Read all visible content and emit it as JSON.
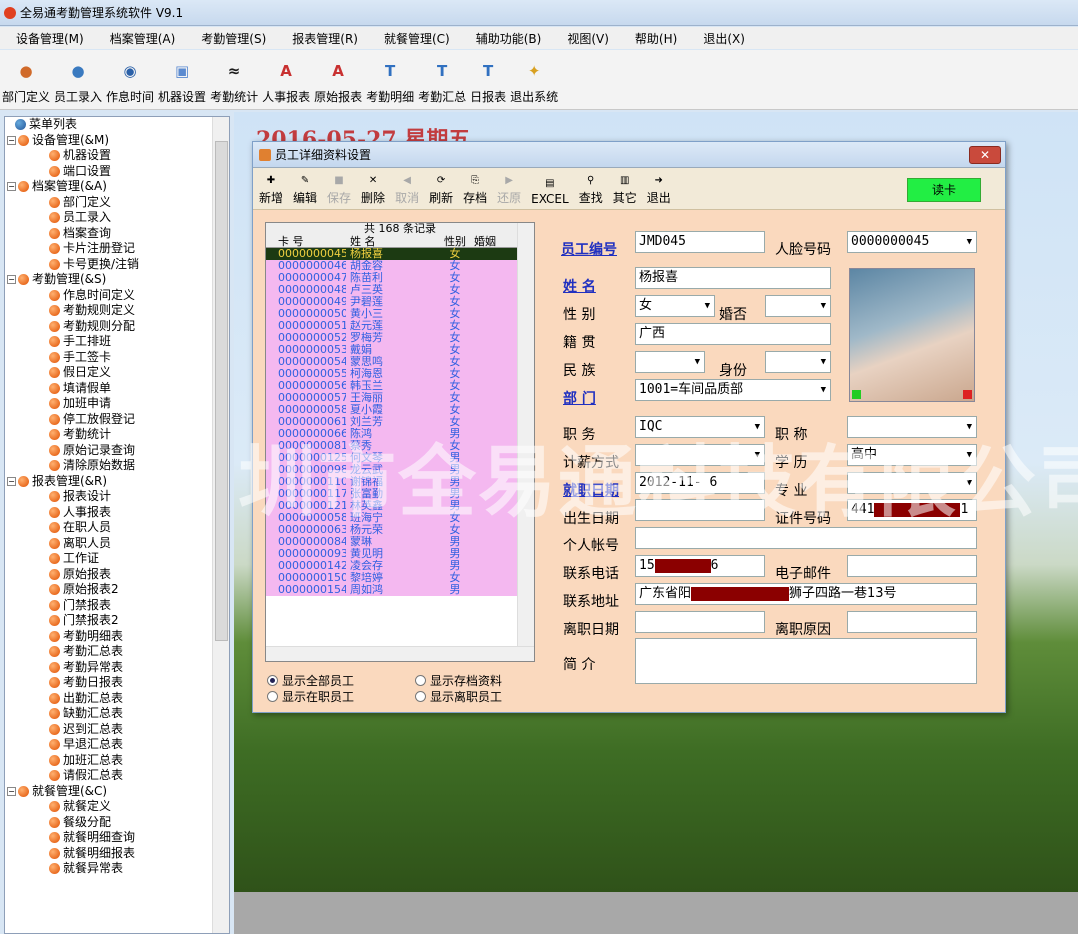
{
  "app": {
    "title": "全易通考勤管理系统软件 V9.1"
  },
  "menu": [
    "设备管理(M)",
    "档案管理(A)",
    "考勤管理(S)",
    "报表管理(R)",
    "就餐管理(C)",
    "辅助功能(B)",
    "视图(V)",
    "帮助(H)",
    "退出(X)"
  ],
  "toolbar": [
    "部门定义",
    "员工录入",
    "作息时间",
    "机器设置",
    "考勤统计",
    "人事报表",
    "原始报表",
    "考勤明细",
    "考勤汇总",
    "日报表",
    "退出系统"
  ],
  "tree": [
    {
      "label": "菜单列表",
      "level": 0
    },
    {
      "label": "设备管理(&M)",
      "level": 1
    },
    {
      "label": "机器设置",
      "level": 2
    },
    {
      "label": "端口设置",
      "level": 2
    },
    {
      "label": "档案管理(&A)",
      "level": 1
    },
    {
      "label": "部门定义",
      "level": 2
    },
    {
      "label": "员工录入",
      "level": 2
    },
    {
      "label": "档案查询",
      "level": 2
    },
    {
      "label": "卡片注册登记",
      "level": 2
    },
    {
      "label": "卡号更换/注销",
      "level": 2
    },
    {
      "label": "考勤管理(&S)",
      "level": 1
    },
    {
      "label": "作息时间定义",
      "level": 2
    },
    {
      "label": "考勤规则定义",
      "level": 2
    },
    {
      "label": "考勤规则分配",
      "level": 2
    },
    {
      "label": "手工排班",
      "level": 2
    },
    {
      "label": "手工签卡",
      "level": 2
    },
    {
      "label": "假日定义",
      "level": 2
    },
    {
      "label": "填请假单",
      "level": 2
    },
    {
      "label": "加班申请",
      "level": 2
    },
    {
      "label": "停工放假登记",
      "level": 2
    },
    {
      "label": "考勤统计",
      "level": 2
    },
    {
      "label": "原始记录查询",
      "level": 2
    },
    {
      "label": "清除原始数据",
      "level": 2
    },
    {
      "label": "报表管理(&R)",
      "level": 1
    },
    {
      "label": "报表设计",
      "level": 2
    },
    {
      "label": "人事报表",
      "level": 2
    },
    {
      "label": "在职人员",
      "level": 2
    },
    {
      "label": "离职人员",
      "level": 2
    },
    {
      "label": "工作证",
      "level": 2
    },
    {
      "label": "原始报表",
      "level": 2
    },
    {
      "label": "原始报表2",
      "level": 2
    },
    {
      "label": "门禁报表",
      "level": 2
    },
    {
      "label": "门禁报表2",
      "level": 2
    },
    {
      "label": "考勤明细表",
      "level": 2
    },
    {
      "label": "考勤汇总表",
      "level": 2
    },
    {
      "label": "考勤异常表",
      "level": 2
    },
    {
      "label": "考勤日报表",
      "level": 2
    },
    {
      "label": "出勤汇总表",
      "level": 2
    },
    {
      "label": "缺勤汇总表",
      "level": 2
    },
    {
      "label": "迟到汇总表",
      "level": 2
    },
    {
      "label": "早退汇总表",
      "level": 2
    },
    {
      "label": "加班汇总表",
      "level": 2
    },
    {
      "label": "请假汇总表",
      "level": 2
    },
    {
      "label": "就餐管理(&C)",
      "level": 1
    },
    {
      "label": "就餐定义",
      "level": 2
    },
    {
      "label": "餐级分配",
      "level": 2
    },
    {
      "label": "就餐明细查询",
      "level": 2
    },
    {
      "label": "就餐明细报表",
      "level": 2
    },
    {
      "label": "就餐异常表",
      "level": 2
    }
  ],
  "desktop": {
    "date": "2016-05-27 星期五",
    "watermark": "圳市全易通科技有限公司"
  },
  "dialog": {
    "title": "员工详细资料设置",
    "toolbar": [
      {
        "label": "新增",
        "enabled": true
      },
      {
        "label": "编辑",
        "enabled": true
      },
      {
        "label": "保存",
        "enabled": false
      },
      {
        "label": "删除",
        "enabled": true
      },
      {
        "label": "取消",
        "enabled": false
      },
      {
        "label": "刷新",
        "enabled": true
      },
      {
        "label": "存档",
        "enabled": true
      },
      {
        "label": "还原",
        "enabled": false
      },
      {
        "label": "EXCEL",
        "enabled": true
      },
      {
        "label": "查找",
        "enabled": true
      },
      {
        "label": "其它",
        "enabled": true
      },
      {
        "label": "退出",
        "enabled": true
      }
    ],
    "read_card": "读卡",
    "grid": {
      "count_label": "共 168 条记录",
      "headers": [
        "卡  号",
        "姓  名",
        "性别",
        "婚姻"
      ],
      "rows": [
        [
          "0000000045",
          "杨报喜",
          "女"
        ],
        [
          "0000000046",
          "胡金容",
          "女"
        ],
        [
          "0000000047",
          "陈苗利",
          "女"
        ],
        [
          "0000000048",
          "卢三英",
          "女"
        ],
        [
          "0000000049",
          "尹碧莲",
          "女"
        ],
        [
          "0000000050",
          "黄小三",
          "女"
        ],
        [
          "0000000051",
          "赵元莲",
          "女"
        ],
        [
          "0000000052",
          "罗梅芳",
          "女"
        ],
        [
          "0000000053",
          "戴娟",
          "女"
        ],
        [
          "0000000054",
          "蒙思鸣",
          "女"
        ],
        [
          "0000000055",
          "柯海恩",
          "女"
        ],
        [
          "0000000056",
          "韩玉兰",
          "女"
        ],
        [
          "0000000057",
          "王海丽",
          "女"
        ],
        [
          "0000000058",
          "夏小霞",
          "女"
        ],
        [
          "0000000061",
          "刘兰芳",
          "女"
        ],
        [
          "0000000066",
          "陈鸿",
          "男"
        ],
        [
          "0000000081",
          "蔡秀",
          "女"
        ],
        [
          "0000000125",
          "何文琴",
          "男"
        ],
        [
          "0000000098",
          "龙云武",
          "男"
        ],
        [
          "0000000110",
          "谢锦福",
          "男"
        ],
        [
          "0000000117",
          "张富勤",
          "男"
        ],
        [
          "0000000121",
          "林英鑫",
          "男"
        ],
        [
          "0000000058",
          "班海宁",
          "女"
        ],
        [
          "0000000063",
          "杨元荣",
          "女"
        ],
        [
          "0000000084",
          "蒙琳",
          "男"
        ],
        [
          "0000000093",
          "黄见明",
          "男"
        ],
        [
          "0000000142",
          "凌会存",
          "男"
        ],
        [
          "0000000150",
          "黎培婷",
          "女"
        ],
        [
          "0000000154",
          "周如鸿",
          "男"
        ]
      ]
    },
    "radios": [
      {
        "label": "显示全部员工",
        "checked": true
      },
      {
        "label": "显示存档资料",
        "checked": false
      },
      {
        "label": "显示在职员工",
        "checked": false
      },
      {
        "label": "显示离职员工",
        "checked": false
      }
    ],
    "form": {
      "emp_no_label": "员工编号",
      "emp_no": "JMD045",
      "face_label": "人脸号码",
      "face_no": "0000000045",
      "name_label": "姓    名",
      "name": "杨报喜",
      "gender_label": "性    别",
      "gender": "女",
      "marital_label": "婚否",
      "marital": "",
      "origin_label": "籍    贯",
      "origin": "广西",
      "nation_label": "民    族",
      "nation": "",
      "identity_label": "身份",
      "identity": "",
      "dept_label": "部    门",
      "dept": "1001=车间品质部",
      "position_label": "职    务",
      "position": "IQC",
      "title_label": "职    称",
      "title": "",
      "salary_label": "计薪方式",
      "salary": "",
      "edu_label": "学    历",
      "edu": "高中",
      "hire_label": "就职日期",
      "hire": "2012-11- 6",
      "major_label": "专    业",
      "major": "",
      "birth_label": "出生日期",
      "birth": "",
      "id_label": "证件号码",
      "id_prefix": "441",
      "id_suffix": "1",
      "account_label": "个人帐号",
      "account": "",
      "phone_label": "联系电话",
      "phone_prefix": "15",
      "phone_suffix": "6",
      "email_label": "电子邮件",
      "email": "",
      "address_label": "联系地址",
      "address_prefix": "广东省阳",
      "address_suffix": "狮子四路一巷13号",
      "leave_label": "离职日期",
      "leave": "",
      "leave_reason_label": "离职原因",
      "leave_reason": "",
      "intro_label": "简    介",
      "intro": ""
    }
  }
}
